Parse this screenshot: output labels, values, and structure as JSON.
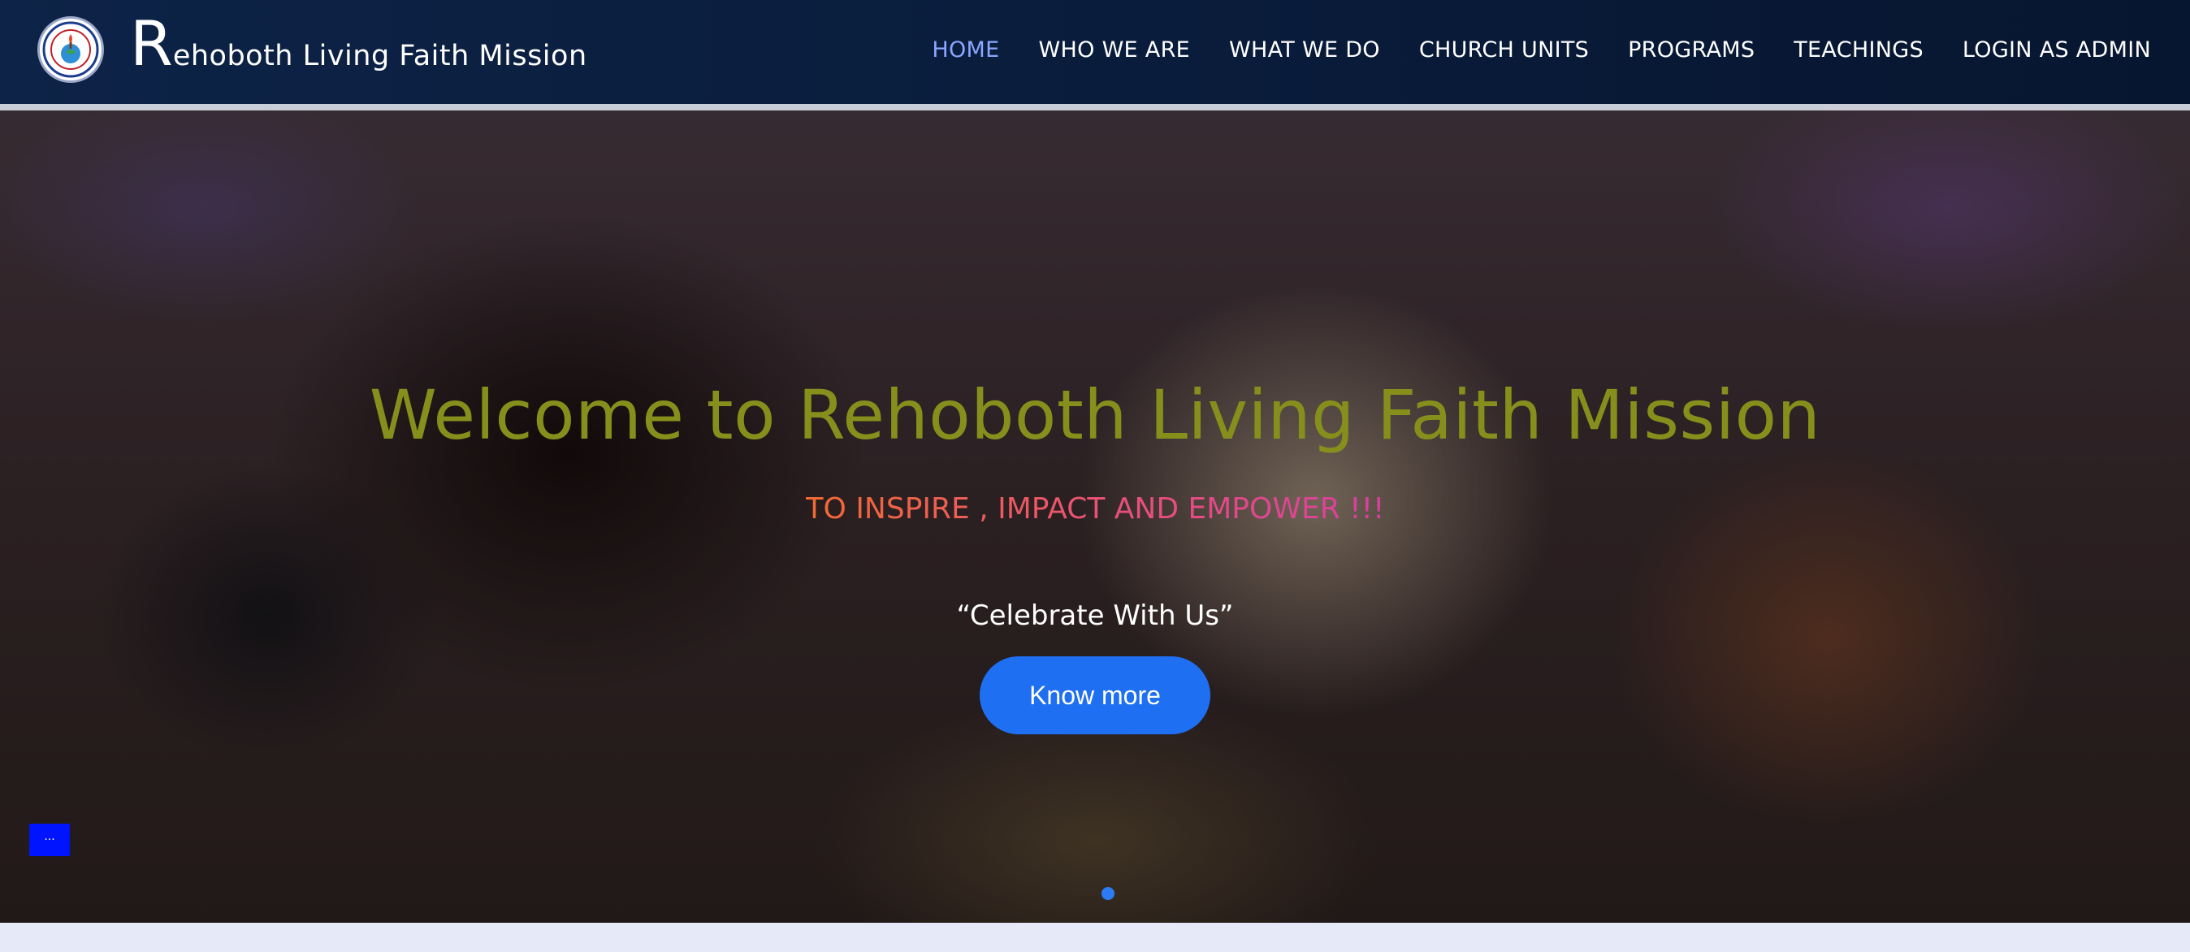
{
  "brand": {
    "initial": "R",
    "rest": "ehoboth Living Faith Mission",
    "logo_icon": "church-seal-logo"
  },
  "nav": {
    "items": [
      {
        "label": "HOME",
        "active": true
      },
      {
        "label": "WHO WE ARE",
        "active": false
      },
      {
        "label": "WHAT WE DO",
        "active": false
      },
      {
        "label": "CHURCH UNITS",
        "active": false
      },
      {
        "label": "PROGRAMS",
        "active": false
      },
      {
        "label": "TEACHINGS",
        "active": false
      },
      {
        "label": "LOGIN AS ADMIN",
        "active": false
      }
    ]
  },
  "hero": {
    "title": "Welcome to Rehoboth Living Faith Mission",
    "tagline": "TO INSPIRE , IMPACT AND EMPOWER !!!",
    "quote": "“Celebrate With Us”",
    "button_label": "Know more",
    "slide_count": 1,
    "active_slide": 1
  },
  "colors": {
    "nav_bg": "#0a1d3d",
    "nav_active": "#8aa6ff",
    "title": "#878f1c",
    "tagline_start": "#f16a32",
    "tagline_end": "#d83fa0",
    "button": "#1f6ff2",
    "dot": "#2d7cf6",
    "chat_widget": "#0014ff"
  }
}
